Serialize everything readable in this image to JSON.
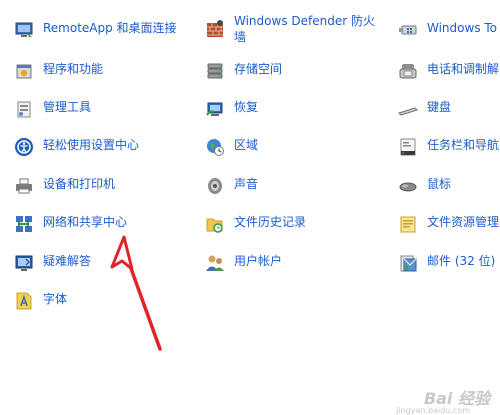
{
  "columns": [
    {
      "items": [
        {
          "label": "RemoteApp 和桌面连接",
          "icon": "remote-desktop-icon"
        },
        {
          "label": "程序和功能",
          "icon": "programs-icon"
        },
        {
          "label": "管理工具",
          "icon": "admin-tools-icon"
        },
        {
          "label": "轻松使用设置中心",
          "icon": "ease-of-access-icon"
        },
        {
          "label": "设备和打印机",
          "icon": "printer-icon"
        },
        {
          "label": "网络和共享中心",
          "icon": "network-icon"
        },
        {
          "label": "疑难解答",
          "icon": "troubleshoot-icon"
        },
        {
          "label": "字体",
          "icon": "fonts-icon"
        }
      ]
    },
    {
      "items": [
        {
          "label": "Windows Defender 防火墙",
          "icon": "firewall-icon"
        },
        {
          "label": "存储空间",
          "icon": "storage-icon"
        },
        {
          "label": "恢复",
          "icon": "recovery-icon"
        },
        {
          "label": "区域",
          "icon": "region-icon"
        },
        {
          "label": "声音",
          "icon": "sound-icon"
        },
        {
          "label": "文件历史记录",
          "icon": "file-history-icon"
        },
        {
          "label": "用户帐户",
          "icon": "user-accounts-icon"
        }
      ]
    },
    {
      "items": [
        {
          "label": "Windows To",
          "icon": "windows-to-go-icon"
        },
        {
          "label": "电话和调制解",
          "icon": "phone-modem-icon"
        },
        {
          "label": "键盘",
          "icon": "keyboard-icon"
        },
        {
          "label": "任务栏和导航",
          "icon": "taskbar-icon"
        },
        {
          "label": "鼠标",
          "icon": "mouse-icon"
        },
        {
          "label": "文件资源管理",
          "icon": "file-explorer-icon"
        },
        {
          "label": "邮件 (32 位)",
          "icon": "mail-icon"
        }
      ]
    }
  ],
  "watermark": {
    "text": "Bai 经验",
    "sub": "jingyan.baidu.com"
  },
  "colors": {
    "link": "#1a5ccc",
    "arrow": "#e0242a"
  }
}
